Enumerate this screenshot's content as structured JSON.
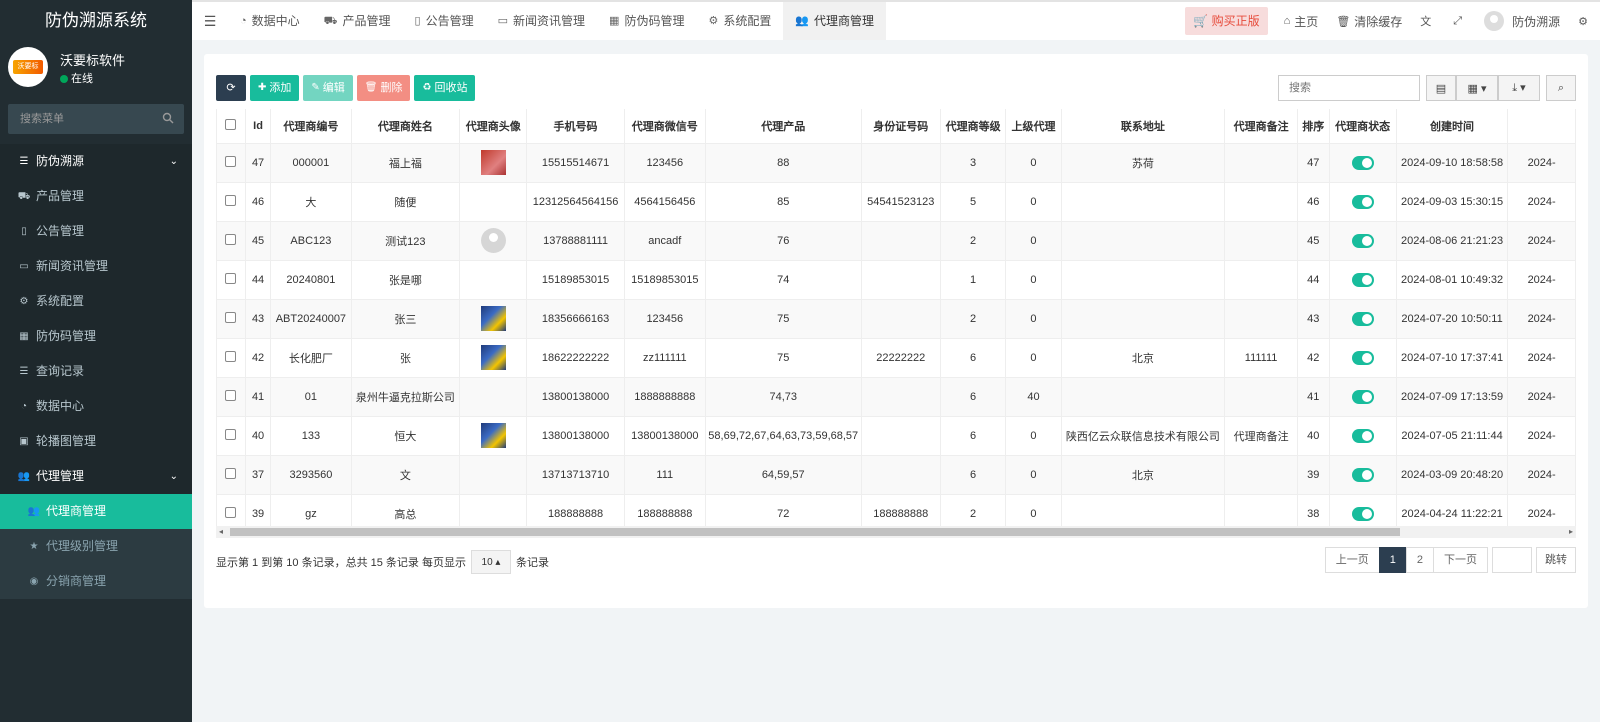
{
  "app": {
    "title": "防伪溯源系统"
  },
  "user": {
    "name": "沃要标软件",
    "status": "在线",
    "logo_text": "沃要标"
  },
  "sidebar": {
    "search_placeholder": "搜索菜单",
    "items": [
      {
        "label": "防伪溯源",
        "icon": "list-icon",
        "type": "group"
      },
      {
        "label": "产品管理",
        "icon": "shopping-bag-icon",
        "type": "item"
      },
      {
        "label": "公告管理",
        "icon": "file-icon",
        "type": "item"
      },
      {
        "label": "新闻资讯管理",
        "icon": "newspaper-icon",
        "type": "item"
      },
      {
        "label": "系统配置",
        "icon": "gear-icon",
        "type": "item"
      },
      {
        "label": "防伪码管理",
        "icon": "qrcode-icon",
        "type": "item"
      },
      {
        "label": "查询记录",
        "icon": "list-icon",
        "type": "item"
      },
      {
        "label": "数据中心",
        "icon": "dashboard-icon",
        "type": "item"
      },
      {
        "label": "轮播图管理",
        "icon": "image-icon",
        "type": "item"
      },
      {
        "label": "代理管理",
        "icon": "users-icon",
        "type": "group"
      },
      {
        "label": "代理商管理",
        "icon": "users-icon",
        "type": "active"
      },
      {
        "label": "代理级别管理",
        "icon": "star-icon",
        "type": "sub"
      },
      {
        "label": "分销商管理",
        "icon": "user-circle-icon",
        "type": "sub"
      }
    ]
  },
  "tabs": [
    {
      "label": "数据中心",
      "icon": "dashboard-icon"
    },
    {
      "label": "产品管理",
      "icon": "shopping-bag-icon"
    },
    {
      "label": "公告管理",
      "icon": "file-icon"
    },
    {
      "label": "新闻资讯管理",
      "icon": "newspaper-icon"
    },
    {
      "label": "防伪码管理",
      "icon": "qrcode-icon"
    },
    {
      "label": "系统配置",
      "icon": "gear-icon"
    },
    {
      "label": "代理商管理",
      "icon": "users-icon",
      "active": true
    }
  ],
  "topbar": {
    "buy": "购买正版",
    "home": "主页",
    "clear_cache": "清除缓存",
    "user": "防伪溯源"
  },
  "toolbar": {
    "add": "添加",
    "edit": "编辑",
    "delete": "删除",
    "recycle": "回收站",
    "search_placeholder": "搜索"
  },
  "table": {
    "headers": [
      "Id",
      "代理商编号",
      "代理商姓名",
      "代理商头像",
      "手机号码",
      "代理商微信号",
      "代理产品",
      "身份证号码",
      "代理商等级",
      "上级代理",
      "联系地址",
      "代理商备注",
      "排序",
      "代理商状态",
      "创建时间"
    ],
    "rows": [
      {
        "id": "47",
        "code": "000001",
        "name": "福上福",
        "avatar": "red",
        "phone": "15515514671",
        "wechat": "123456",
        "products": "88",
        "idcard": "",
        "level": "3",
        "parent": "0",
        "address": "苏荷",
        "remark": "",
        "sort": "47",
        "created": "2024-09-10 18:58:58",
        "updated": "2024-"
      },
      {
        "id": "46",
        "code": "大",
        "name": "随便",
        "avatar": "",
        "phone": "12312564564156",
        "wechat": "4564156456",
        "products": "85",
        "idcard": "54541523123",
        "level": "5",
        "parent": "0",
        "address": "",
        "remark": "",
        "sort": "46",
        "created": "2024-09-03 15:30:15",
        "updated": "2024-"
      },
      {
        "id": "45",
        "code": "ABC123",
        "name": "测试123",
        "avatar": "gray",
        "phone": "13788881111",
        "wechat": "ancadf",
        "products": "76",
        "idcard": "",
        "level": "2",
        "parent": "0",
        "address": "",
        "remark": "",
        "sort": "45",
        "created": "2024-08-06 21:21:23",
        "updated": "2024-"
      },
      {
        "id": "44",
        "code": "20240801",
        "name": "张是哪",
        "avatar": "",
        "phone": "15189853015",
        "wechat": "15189853015",
        "products": "74",
        "idcard": "",
        "level": "1",
        "parent": "0",
        "address": "",
        "remark": "",
        "sort": "44",
        "created": "2024-08-01 10:49:32",
        "updated": "2024-"
      },
      {
        "id": "43",
        "code": "ABT20240007",
        "name": "张三",
        "avatar": "blue",
        "phone": "18356666163",
        "wechat": "123456",
        "products": "75",
        "idcard": "",
        "level": "2",
        "parent": "0",
        "address": "",
        "remark": "",
        "sort": "43",
        "created": "2024-07-20 10:50:11",
        "updated": "2024-"
      },
      {
        "id": "42",
        "code": "长化肥厂",
        "name": "张",
        "avatar": "blue",
        "phone": "18622222222",
        "wechat": "zz111111",
        "products": "75",
        "idcard": "22222222",
        "level": "6",
        "parent": "0",
        "address": "北京",
        "remark": "111111",
        "sort": "42",
        "created": "2024-07-10 17:37:41",
        "updated": "2024-"
      },
      {
        "id": "41",
        "code": "01",
        "name": "泉州牛逼克拉斯公司",
        "avatar": "",
        "phone": "13800138000",
        "wechat": "1888888888",
        "products": "74,73",
        "idcard": "",
        "level": "6",
        "parent": "40",
        "address": "",
        "remark": "",
        "sort": "41",
        "created": "2024-07-09 17:13:59",
        "updated": "2024-"
      },
      {
        "id": "40",
        "code": "133",
        "name": "恒大",
        "avatar": "blue",
        "phone": "13800138000",
        "wechat": "13800138000",
        "products": "58,69,72,67,64,63,73,59,68,57",
        "idcard": "",
        "level": "6",
        "parent": "0",
        "address": "陕西亿云众联信息技术有限公司",
        "remark": "代理商备注",
        "sort": "40",
        "created": "2024-07-05 21:11:44",
        "updated": "2024-"
      },
      {
        "id": "37",
        "code": "3293560",
        "name": "文",
        "avatar": "",
        "phone": "13713713710",
        "wechat": "111",
        "products": "64,59,57",
        "idcard": "",
        "level": "6",
        "parent": "0",
        "address": "北京",
        "remark": "",
        "sort": "39",
        "created": "2024-03-09 20:48:20",
        "updated": "2024-"
      },
      {
        "id": "39",
        "code": "gz",
        "name": "高总",
        "avatar": "",
        "phone": "188888888",
        "wechat": "188888888",
        "products": "72",
        "idcard": "188888888",
        "level": "2",
        "parent": "0",
        "address": "",
        "remark": "",
        "sort": "38",
        "created": "2024-04-24 11:22:21",
        "updated": "2024-"
      }
    ]
  },
  "pagination": {
    "info_prefix": "显示第 1 到第 10 条记录，总共 15 条记录 每页显示",
    "page_size": "10",
    "info_suffix": "条记录",
    "prev": "上一页",
    "pages": [
      "1",
      "2"
    ],
    "next": "下一页",
    "jump": "跳转"
  },
  "colors": {
    "accent": "#18bc9c",
    "sidebar": "#222d32",
    "danger": "#f38e83",
    "dark": "#2c3e50"
  }
}
